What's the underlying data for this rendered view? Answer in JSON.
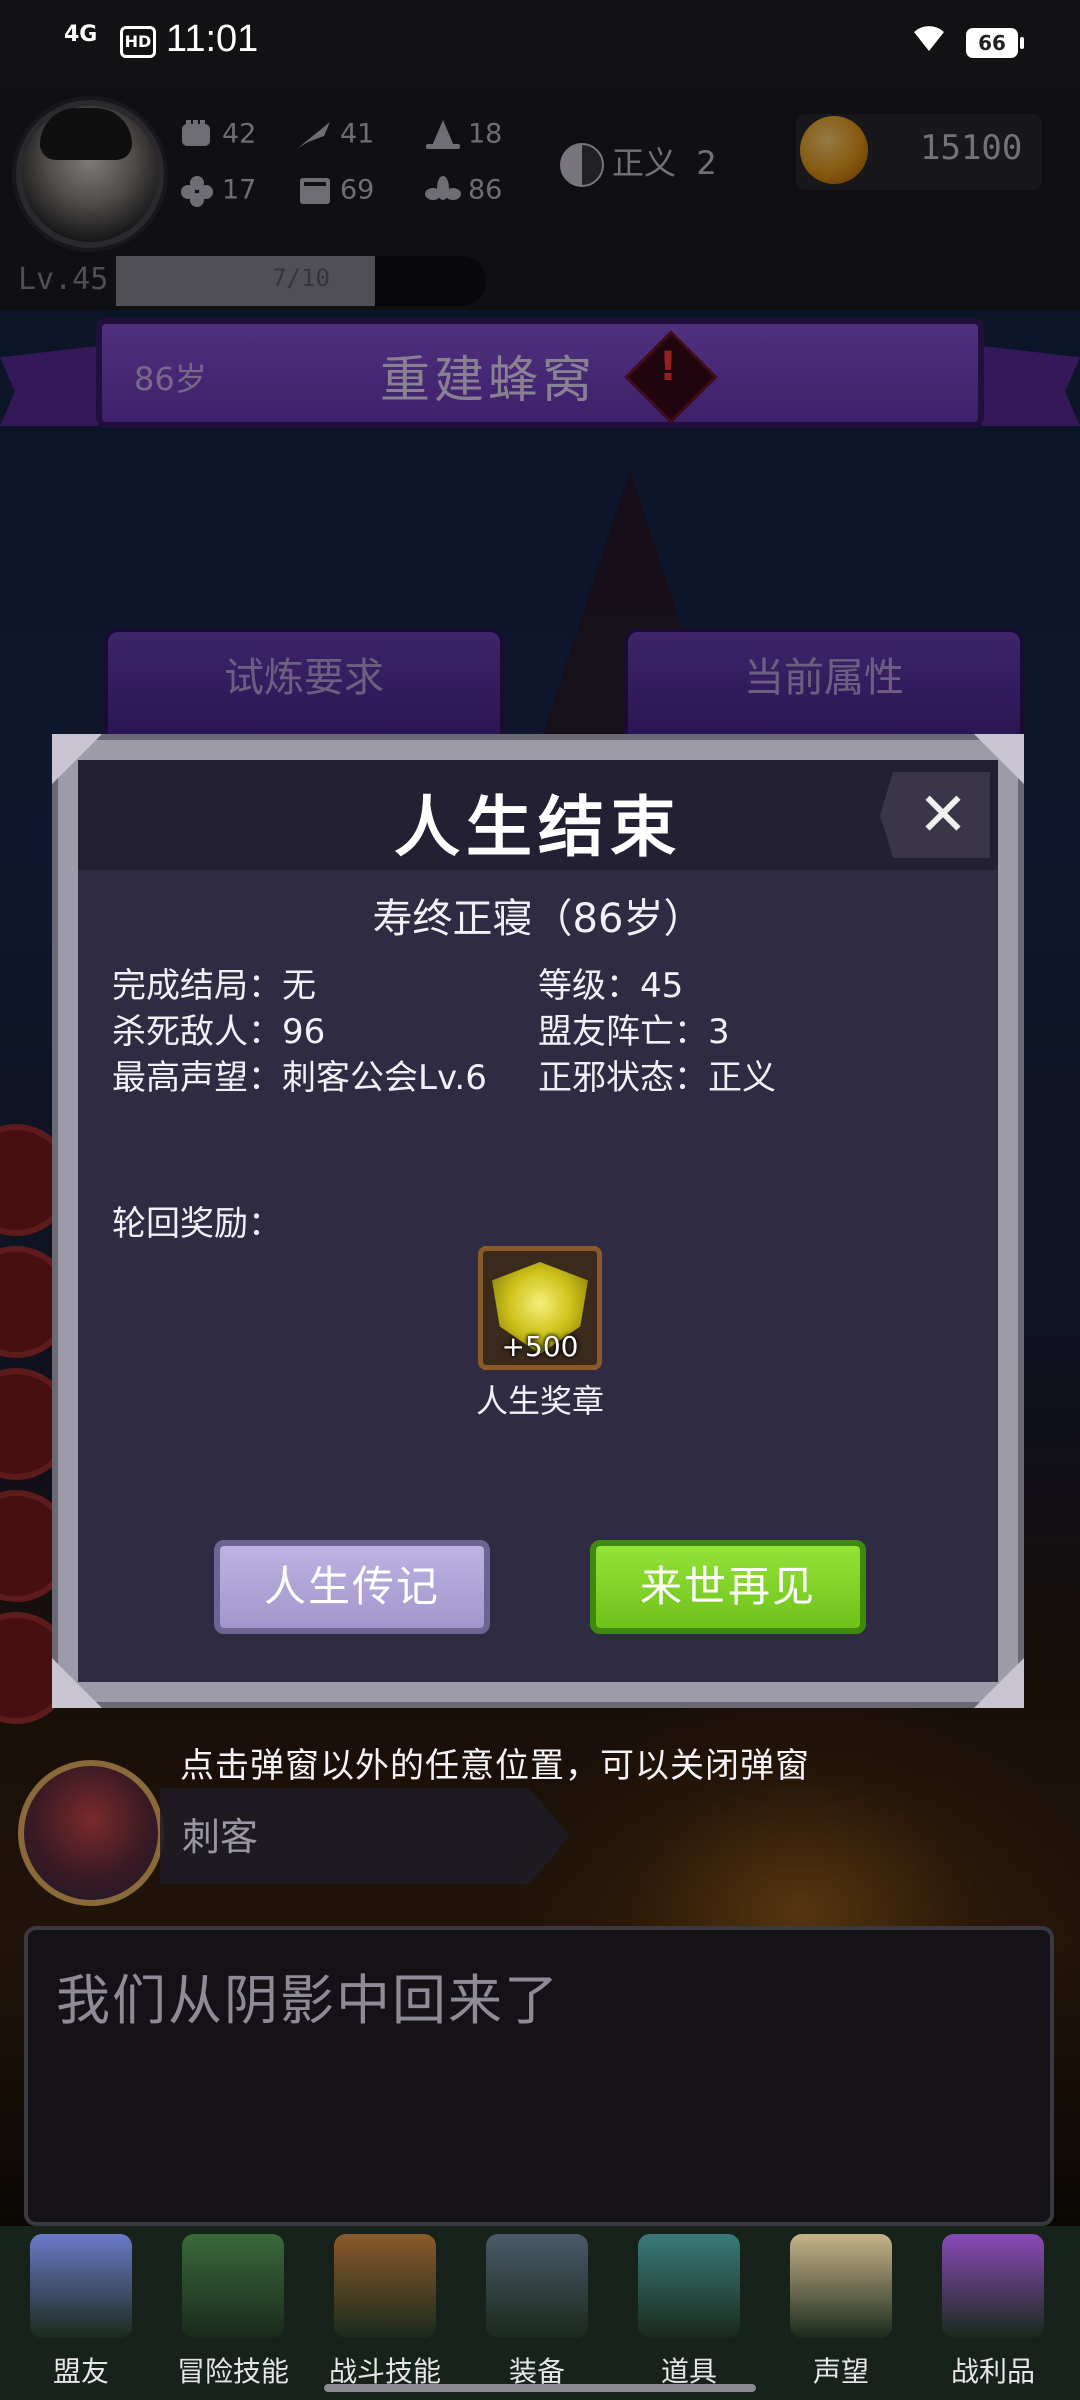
{
  "status_bar": {
    "network": "4G",
    "hd": "HD",
    "time": "11:01",
    "battery": "66"
  },
  "player": {
    "level_label": "Lv.45",
    "xp_text": "7/10",
    "xp_progress": 0.7,
    "stats": [
      {
        "icon": "fist-icon",
        "value": "42"
      },
      {
        "icon": "clover-icon",
        "value": "17"
      },
      {
        "icon": "quill-icon",
        "value": "41"
      },
      {
        "icon": "book-icon",
        "value": "69"
      },
      {
        "icon": "wizard-hat-icon",
        "value": "18"
      },
      {
        "icon": "lotus-icon",
        "value": "86"
      }
    ],
    "alignment_label": "正义",
    "alignment_value": "2",
    "coins": "15100"
  },
  "banner": {
    "age": "86岁",
    "title": "重建蜂窝"
  },
  "tabs": [
    "试炼要求",
    "当前属性"
  ],
  "modal": {
    "title": "人生结束",
    "close_symbol": "✕",
    "subtitle": "寿终正寝（86岁）",
    "info_left": [
      "完成结局：无",
      "杀死敌人：96",
      "最高声望：刺客公会Lv.6"
    ],
    "info_right": [
      "等级：45",
      "盟友阵亡：3",
      "正邪状态：正义"
    ],
    "reward_label": "轮回奖励：",
    "reward": {
      "icon": "medal-icon",
      "quantity": "+500",
      "name": "人生奖章"
    },
    "buttons": {
      "biography": "人生传记",
      "next_life": "来世再见"
    }
  },
  "hint": "点击弹窗以外的任意位置，可以关闭弹窗",
  "speaker": {
    "name": "刺客"
  },
  "dialogue": "我们从阴影中回来了",
  "nav": [
    {
      "label": "盟友",
      "icon": "handshake-icon",
      "color": "#6a7ac8"
    },
    {
      "label": "冒险技能",
      "icon": "spellbook-icon",
      "color": "#3a6a3a"
    },
    {
      "label": "战斗技能",
      "icon": "backpack-icon",
      "color": "#8a5a2a"
    },
    {
      "label": "装备",
      "icon": "crossed-swords-icon",
      "color": "#4a5a6a"
    },
    {
      "label": "道具",
      "icon": "pouch-icon",
      "color": "#3a7a7a"
    },
    {
      "label": "声望",
      "icon": "scroll-icon",
      "color": "#c8b48a"
    },
    {
      "label": "战利品",
      "icon": "treasure-chest-icon",
      "color": "#8a4ab8"
    }
  ]
}
